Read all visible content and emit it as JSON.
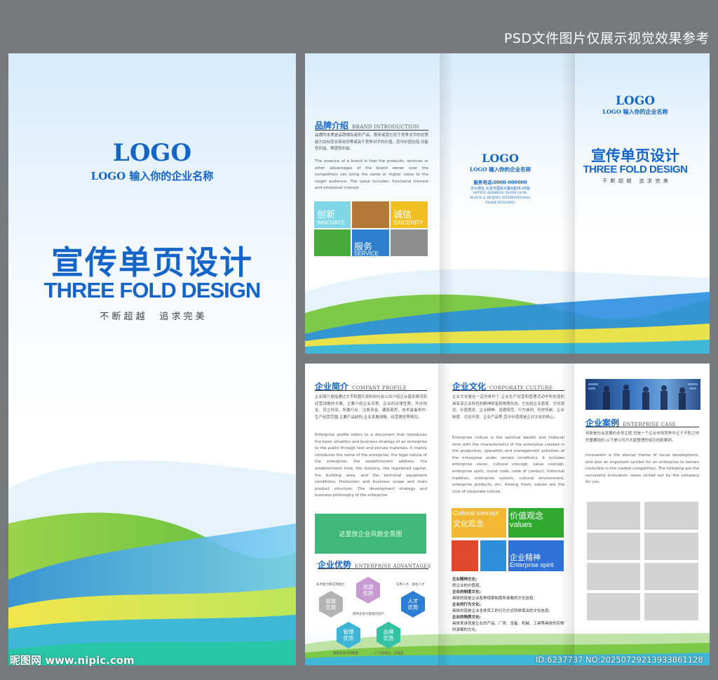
{
  "top_note": "PSD文件图片仅展示视觉效果参考",
  "cover": {
    "logo": "LOGO",
    "company": "LOGO 输入你的企业名称",
    "title_zh": "宣传单页设计",
    "title_en": "THREE FOLD DESIGN",
    "slogan": "不 断 超 越     追 求 完 美"
  },
  "outer": {
    "brand": {
      "heading_zh": "品牌介绍",
      "heading_en": "BRAND INTRODUCTION",
      "para_zh": "品牌的本质是品牌拥有者的产品、服务或其它优于竞争对手的优势能为目标受众带去同等或高于竞争对手的价值。其中价值包括:功能性利益、情感性利益。",
      "para_en": "The essence of a brand is that the products, services or other advantages of the brand owner over the competitors can bring the same or higher value to the target audience. The value includes: functional interest and emotional interest.",
      "tiles": [
        {
          "zh": "创新",
          "en": "INNOVATE",
          "color": "#7fd6e6"
        },
        {
          "zh": "",
          "en": "",
          "color": "#b47838"
        },
        {
          "zh": "诚信",
          "en": "SINCERITY",
          "color": "#f0c020"
        },
        {
          "zh": "",
          "en": "",
          "color": "#47ab3c"
        },
        {
          "zh": "服务",
          "en": "SERVICE",
          "color": "#2f7fd0"
        },
        {
          "zh": "",
          "en": "",
          "color": "#8e8e8e"
        }
      ]
    },
    "back": {
      "logo": "LOGO",
      "company": "LOGO 输入你的企业名称",
      "phone": "服务电话:0000-000000",
      "address": "办公地址:北京市国贸大厦A座28-08室",
      "office_en_1": "OFFICE ADDRESS: ROOM 28-08,",
      "office_en_2": "BLOCK A, BEIJING INTERNATIONAL",
      "office_en_3": "TRADE BUILDING"
    },
    "front": {
      "logo": "LOGO",
      "company": "LOGO 输入你的企业名称",
      "title_zh": "宣传单页设计",
      "title_en": "THREE FOLD DESIGN",
      "slogan": "不  断  超  越     追  求  完  美"
    }
  },
  "inner": {
    "profile": {
      "heading_zh": "企业简介",
      "heading_en": "COMPANY PROFILE",
      "para_zh": "企业简介是指通过文字和图片资料向社会公众介绍企业基本情况和经营战略的文案。主要介绍企业名称、企业的法律性质、开办地址、设立时间、所属行业、注册资金、建筑面积、技术装备条件;生产经营范围;主要产品结构;企业发展战略、经营理念等情况。",
      "para_en": "Enterprise profile refers to a document that introduces the basic situation and business strategy of an enterprise to the public through text and picture materials. It mainly introduces the name of the enterprise, the legal nature of the enterprise, the establishment address, the establishment time, the industry, the registered capital, the building area, and the technical equipment conditions; Production and business scope and main product structure; The development strategy and business philosophy of the enterprise.",
      "photo_label": "这里放企业风貌全景图"
    },
    "advantages": {
      "heading_zh": "企业优势",
      "heading_en": "ENTERPRISE ADVANTAGES",
      "hexes": [
        {
          "label": "技能优势",
          "color": "#b3b3b3"
        },
        {
          "label": "资源优势",
          "color": "#c79bd0"
        },
        {
          "label": "人才优势",
          "color": "#2d7fd6"
        },
        {
          "label": "管理优势",
          "color": "#3fb5d6"
        },
        {
          "label": "品牌优势",
          "color": "#33c2a4"
        }
      ],
      "notes": [
        "技术能力和实用能力",
        "提供竞争力基础的资产",
        "任用人才、留住人才",
        "基础竞争力的管理",
        "广泛影响力、信誉度"
      ]
    },
    "culture": {
      "heading_zh": "企业文化",
      "heading_en": "CORPORATE CULTURE",
      "para_zh": "企业文化是在一定的条件下,企业生产经营和管理活动中所创造的具有该企业特色的精神财富和物质形态。它包括企业愿景、文化观念、价值观念、企业精神、道德规范、行为准则、历史传统、企业制度、文化环境、企业产品等,其中价值观是企业文化的核心。",
      "para_en": "Enterprise culture is the spiritual wealth and material form with the characteristics of the enterprise created in the production, operation and management activities of the enterprise under certain conditions. It includes enterprise vision, cultural concept, value concept, enterprise spirit, moral code, code of conduct, historical tradition, enterprise system, cultural environment, enterprise products, etc. Among them, values are the core of corporate culture.",
      "tiles": [
        {
          "line1": "Cultural concept",
          "line2": "文化观念",
          "color": "#f2b733"
        },
        {
          "line1": "价值观念",
          "line2": "values",
          "color": "#2faa2f"
        },
        {
          "line1": "",
          "line2": "",
          "color": "#e0482a"
        },
        {
          "line1": "",
          "line2": "",
          "color": "#2e8fd8"
        },
        {
          "line1": "企业精神",
          "line2": "Enterprise spirit",
          "color": "#2e72d8"
        }
      ],
      "list": [
        {
          "label": "企业精神文化:",
          "text": "即企业的价值观。"
        },
        {
          "label": "企业的制度文化:",
          "text": "具体的就是企业各种规章制度所承载的文化信息;"
        },
        {
          "label": "企业的行为文化:",
          "text": "具体的就是企业全体员工的行为方式所体现出的文化信息;"
        },
        {
          "label": "企业的物质文化:",
          "text": "具体来讲就是企业的产品、厂房、设备、机械、工具等具体的实物所承载的文化。"
        }
      ]
    },
    "cases": {
      "heading_zh": "企业案例",
      "heading_en": "ENTERPRISE CASE",
      "para_zh": "创新是社会发展的永恒主题,也是一个企业市场竞争中立于不败之地的重要砝码,以下是公司为大家整理的成功创新案例。",
      "para_en": "Innovation is the eternal theme of social development, and also an important symbol for an enterprise to remain invincible in the market competition. The following are the successful innovation cases sorted out by the company for you."
    }
  },
  "watermark_left": "昵图网 www.nipic.com",
  "watermark_right": "ID:6237737 NO:20250729213933861128"
}
